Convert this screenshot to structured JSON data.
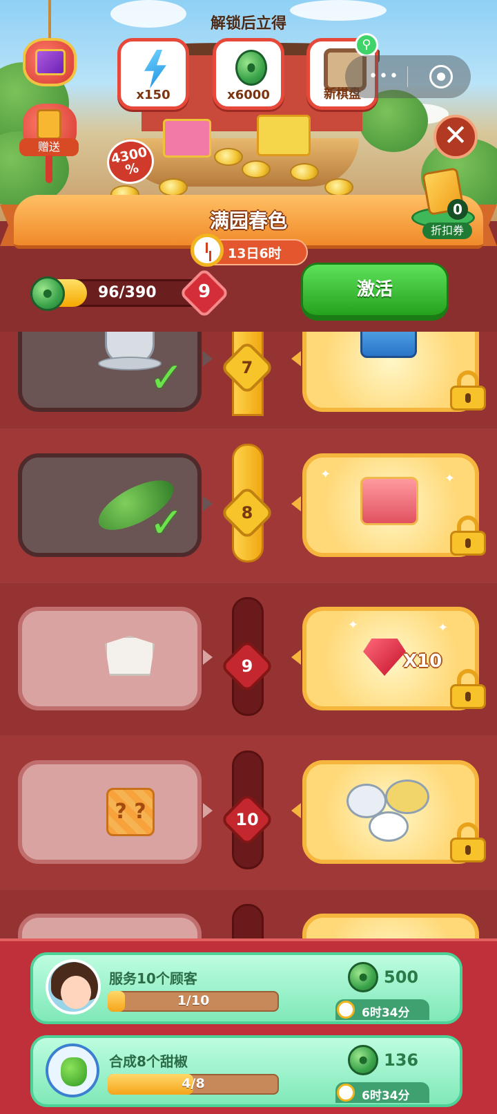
{
  "banner": {
    "unlock_title": "解锁后立得",
    "rewards": [
      {
        "icon": "energy-bolt-icon",
        "amount": "x150"
      },
      {
        "icon": "jade-coin-icon",
        "amount": "x6000"
      },
      {
        "icon": "chessboard-icon",
        "amount": "新棋盘"
      }
    ],
    "gift_label": "赠送",
    "bonus_percent_top": "4300",
    "bonus_percent_bottom": "%",
    "coupon_count": "0",
    "coupon_label": "折扣券"
  },
  "event": {
    "title": "满园春色",
    "timer": "13日6时"
  },
  "progress": {
    "value_text": "96/390",
    "fraction": 0.246,
    "level": "9",
    "activate_label": "激活"
  },
  "tiers": [
    {
      "level": "7",
      "free_item": "tea-cup",
      "claimed": true,
      "paid_item": "blue-chest",
      "locked": true
    },
    {
      "level": "8",
      "free_item": "cucumber",
      "claimed": true,
      "paid_item": "red-chest",
      "locked": true
    },
    {
      "level": "9",
      "free_item": "takeout-box",
      "claimed": false,
      "paid_item": "ruby",
      "paid_qty": "X10",
      "locked": true
    },
    {
      "level": "10",
      "free_item": "mystery-box",
      "claimed": false,
      "paid_item": "food-set",
      "locked": true
    }
  ],
  "quests": [
    {
      "title": "服务10个顾客",
      "progress_text": "1/10",
      "fraction": 0.1,
      "reward": "500",
      "timer": "6时34分"
    },
    {
      "title": "合成8个甜椒",
      "progress_text": "4/8",
      "fraction": 0.5,
      "reward": "136",
      "timer": "6时34分"
    }
  ],
  "colors": {
    "accent_green": "#25a11e",
    "tier_gold": "#f7c52a",
    "tier_red": "#c4282e",
    "quest_green": "#7fe8b8"
  }
}
